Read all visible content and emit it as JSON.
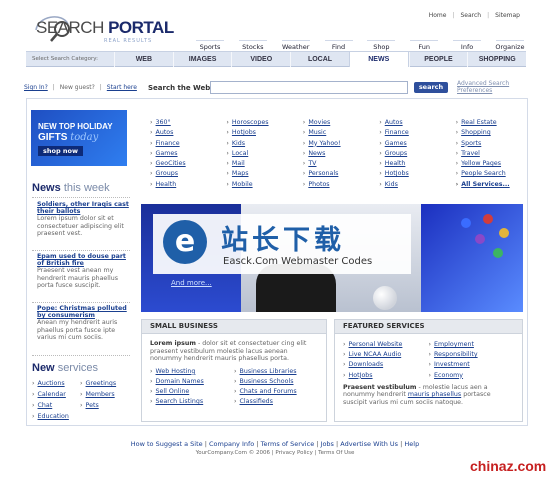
{
  "logo": {
    "title_a": "SEARCH",
    "title_b": " PORTAL",
    "subtitle": "REAL RESULTS"
  },
  "toplinks": [
    "Home",
    "Search",
    "Sitemap"
  ],
  "categories": [
    "Sports",
    "Stocks",
    "Weather",
    "Find",
    "Shop",
    "Fun",
    "Info",
    "Organize"
  ],
  "tabbar": {
    "label": "Select Search Category:",
    "tabs": [
      "WEB",
      "IMAGES",
      "VIDEO",
      "LOCAL",
      "NEWS",
      "PEOPLE",
      "SHOPPING"
    ],
    "active": "NEWS"
  },
  "account": {
    "sign_in": "Sign In?",
    "new_guest": "New guest?",
    "start_here": "Start here"
  },
  "search": {
    "label": "Search the Web:",
    "value": "",
    "button": "search",
    "advanced_1": "Advanced Search",
    "advanced_2": "Preferences"
  },
  "promo": {
    "line1": "NEW TOP HOLIDAY",
    "line2": "GIFTS",
    "line2_italic": "today",
    "button": "shop now"
  },
  "news": {
    "title": "News",
    "title_suffix": "this week",
    "items": [
      {
        "headline": "Soldiers, other Iraqis cast their ballots",
        "body": "Lorem ipsum dolor sit et consectetuer adipiscing elit praesent vest."
      },
      {
        "headline": "Epam used to douse part of British fire",
        "body": "Praesent vest anean my hendrerit mauris phaellus porta fusce suscipit."
      },
      {
        "headline": "Pope: Christmas polluted by consumerism",
        "body": "Anean my hendrerit auris phaellus porta fusce ipte varius mi cum sociis."
      }
    ]
  },
  "services": {
    "title": "New",
    "title_suffix": "services",
    "items": [
      "Auctions",
      "Greetings",
      "Calendar",
      "Members",
      "Chat",
      "Pets",
      "Education"
    ]
  },
  "link_columns": [
    [
      "360°",
      "Autos",
      "Finance",
      "Games",
      "GeoCities",
      "Groups",
      "Health"
    ],
    [
      "Horoscopes",
      "HotJobs",
      "Kids",
      "Local",
      "Mail",
      "Maps",
      "Mobile"
    ],
    [
      "Movies",
      "Music",
      "My Yahoo!",
      "News",
      "TV",
      "Personals",
      "Photos"
    ],
    [
      "Autos",
      "Finance",
      "Games",
      "Groups",
      "Health",
      "HotJobs",
      "Kids"
    ],
    [
      "Real Estate",
      "Shopping",
      "Sports",
      "Travel",
      "Yellow Pages",
      "People Search",
      "All Services..."
    ]
  ],
  "banner": {
    "more": "And more...",
    "watermark_cn": "站长下载",
    "watermark_en": "Easck.Com Webmaster Codes"
  },
  "small_business": {
    "title": "SMALL BUSINESS",
    "intro_bold": "Lorem ipsum",
    "intro": " - dolor sit et consectetuer cing elit praesent vestibulum molestie lacus aenean nonummy hendrerit mauris phasellus porta.",
    "links": [
      "Web Hosting",
      "Business Libraries",
      "Domain Names",
      "Business Schools",
      "Sell Online",
      "Chats and Forums",
      "Search Listings",
      "Classifieds"
    ]
  },
  "featured_services": {
    "title": "FEATURED SERVICES",
    "links": [
      "Personal Website",
      "Employment",
      "Live NCAA Audio",
      "Responsibility",
      "Downloads",
      "Investment",
      "HotJobs",
      "Economy"
    ],
    "outro_bold": "Praesent vestibulum",
    "outro_a": " - molestie lacus aen a nonummy hendrerit ",
    "outro_link": "mauris phasellus",
    "outro_b": " portasce suscipit varius mi cum sociis natoque."
  },
  "footer": {
    "links": [
      "How to Suggest a Site",
      "Company Info",
      "Terms of Service",
      "Jobs",
      "Advertise With Us",
      "Help"
    ],
    "copyright": "YourCompany.Com © 2006  |  Privacy Policy  |  Terms Of Use"
  },
  "site_watermark": "chinaz.com"
}
